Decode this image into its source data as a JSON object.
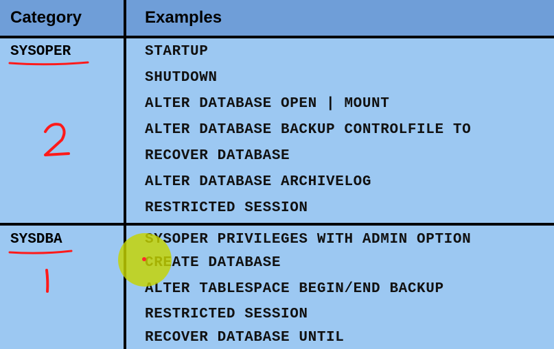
{
  "table": {
    "headers": {
      "category": "Category",
      "examples": "Examples"
    },
    "rows": [
      {
        "category": "SYSOPER",
        "annotation": "2",
        "examples": [
          "STARTUP",
          "SHUTDOWN",
          "ALTER DATABASE OPEN | MOUNT",
          "ALTER DATABASE BACKUP CONTROLFILE TO",
          "RECOVER DATABASE",
          "ALTER DATABASE ARCHIVELOG",
          "RESTRICTED SESSION"
        ]
      },
      {
        "category": "SYSDBA",
        "annotation": "1",
        "examples": [
          "SYSOPER PRIVILEGES WITH ADMIN OPTION",
          "CREATE DATABASE",
          "ALTER TABLESPACE BEGIN/END BACKUP",
          "RESTRICTED SESSION",
          "RECOVER DATABASE UNTIL"
        ]
      }
    ]
  },
  "colors": {
    "header_bg": "#6f9ed8",
    "body_bg": "#9cc8f2",
    "annotation_red": "#ff1a1a",
    "pointer_highlight": "#c6d400"
  }
}
